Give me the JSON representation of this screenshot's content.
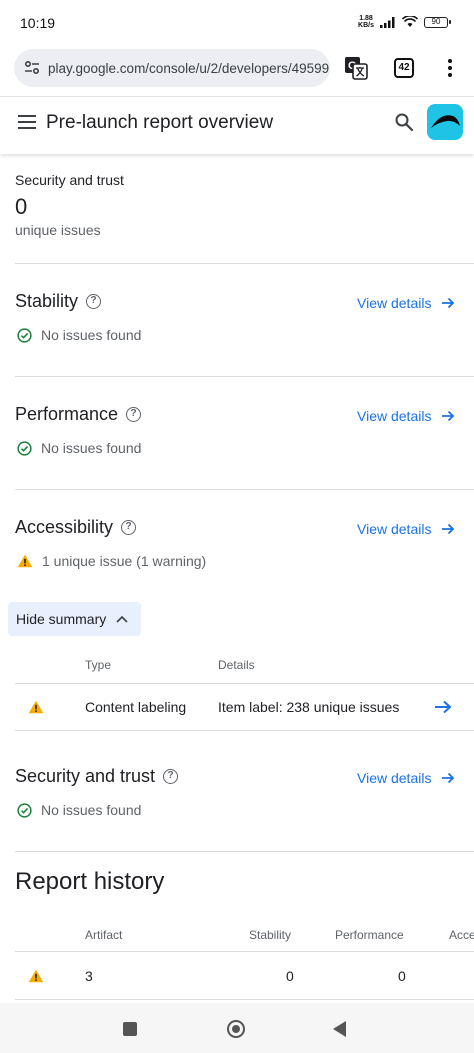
{
  "status_bar": {
    "time": "10:19",
    "net_speed_value": "1.88",
    "net_speed_unit": "KB/s",
    "battery": "90"
  },
  "browser": {
    "url": "play.google.com/console/u/2/developers/49599",
    "tab_count": "42"
  },
  "header": {
    "title": "Pre-launch report overview"
  },
  "security_summary": {
    "label": "Security and trust",
    "count": "0",
    "sublabel": "unique issues"
  },
  "sections": {
    "stability": {
      "title": "Stability",
      "link": "View details",
      "status": "No issues found"
    },
    "performance": {
      "title": "Performance",
      "link": "View details",
      "status": "No issues found"
    },
    "accessibility": {
      "title": "Accessibility",
      "link": "View details",
      "status": "1 unique issue (1 warning)"
    },
    "security": {
      "title": "Security and trust",
      "link": "View details",
      "status": "No issues found"
    }
  },
  "summary_toggle": "Hide summary",
  "accessibility_table": {
    "columns": [
      "Type",
      "Details"
    ],
    "rows": [
      {
        "type": "Content labeling",
        "details": "Item label: 238 unique issues"
      }
    ]
  },
  "report_history": {
    "title": "Report history",
    "columns": [
      "Artifact",
      "Stability",
      "Performance",
      "Acce"
    ],
    "rows": [
      {
        "artifact": "3",
        "stability": "0",
        "performance": "0"
      }
    ]
  },
  "icons": {
    "warning_color": "#f9ab00",
    "success_color": "#188038",
    "link_color": "#1a73e8"
  }
}
